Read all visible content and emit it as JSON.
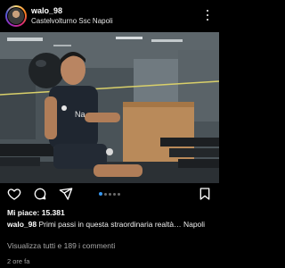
{
  "header": {
    "username": "walo_98",
    "location": "Castelvolturno Ssc Napoli"
  },
  "photo": {
    "jersey_text": "Na"
  },
  "actions": {
    "icons": [
      "heart-icon",
      "comment-icon",
      "share-icon",
      "bookmark-icon"
    ],
    "carousel_dots": 5,
    "active_dot": 1,
    "accent_color": "#3797f0"
  },
  "post": {
    "likes_label": "Mi piace: 15.381",
    "caption_user": "walo_98",
    "caption_text": "Primi passi in questa straordinaria realtà… Napoli",
    "view_comments": "Visualizza tutti e 189 i commenti",
    "time_ago": "2 ore fa"
  }
}
